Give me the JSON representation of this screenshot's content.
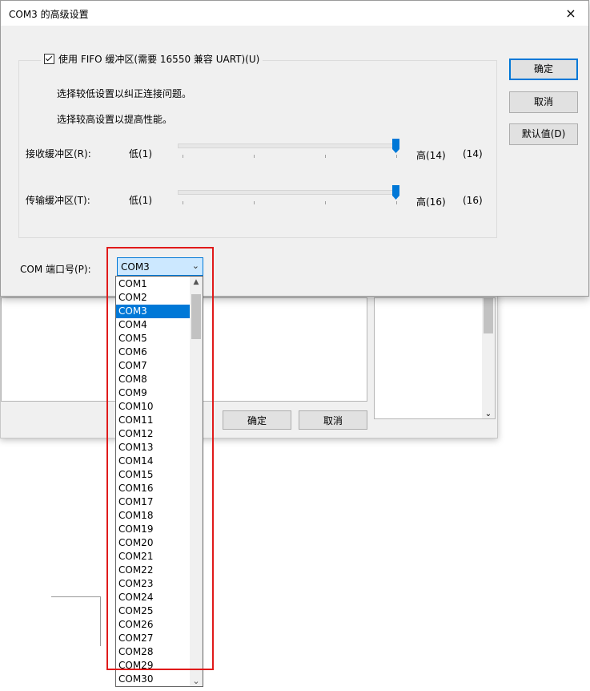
{
  "dialog": {
    "title": "COM3 的高级设置",
    "close_icon": "×",
    "fifo_label": "使用 FIFO 缓冲区(需要 16550 兼容 UART)(U)",
    "fifo_checked": true,
    "hint_low": "选择较低设置以纠正连接问题。",
    "hint_high": "选择较高设置以提高性能。",
    "receive": {
      "label": "接收缓冲区(R):",
      "low": "低(1)",
      "high": "高(14)",
      "value": "(14)",
      "level": 1.0
    },
    "transmit": {
      "label": "传输缓冲区(T):",
      "low": "低(1)",
      "high": "高(16)",
      "value": "(16)",
      "level": 1.0
    },
    "buttons": {
      "ok": "确定",
      "cancel": "取消",
      "defaults": "默认值(D)"
    },
    "port_label": "COM 端口号(P):",
    "port_value": "COM3",
    "port_arrow": "⌄"
  },
  "dropdown": {
    "selected": "COM3",
    "items": [
      "COM1",
      "COM2",
      "COM3",
      "COM4",
      "COM5",
      "COM6",
      "COM7",
      "COM8",
      "COM9",
      "COM10",
      "COM11",
      "COM12",
      "COM13",
      "COM14",
      "COM15",
      "COM16",
      "COM17",
      "COM18",
      "COM19",
      "COM20",
      "COM21",
      "COM22",
      "COM23",
      "COM24",
      "COM25",
      "COM26",
      "COM27",
      "COM28",
      "COM29",
      "COM30"
    ],
    "up_arrow": "▲",
    "down_arrow": "⌄"
  },
  "background_window": {
    "ok": "确定",
    "cancel": "取消",
    "scroll_down": "⌄"
  },
  "colors": {
    "accent": "#0078d7",
    "highlight_box": "#e01a1a"
  }
}
